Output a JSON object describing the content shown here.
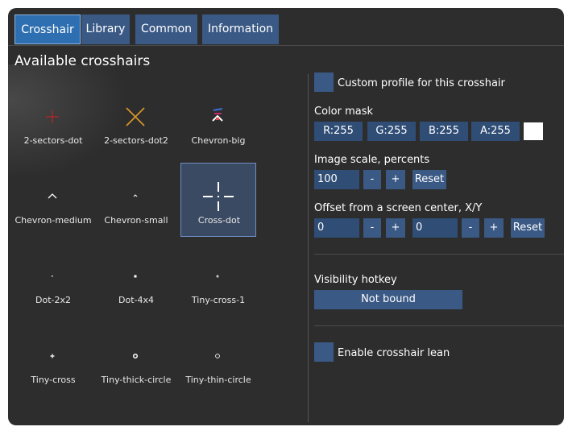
{
  "tabs": [
    {
      "label": "Crosshair"
    },
    {
      "label": "Library"
    },
    {
      "label": "Common"
    },
    {
      "label": "Information"
    }
  ],
  "section_title": "Available crosshairs",
  "crosshairs": [
    {
      "label": "2-sectors-dot",
      "icon": "red-plus-crosshair-icon"
    },
    {
      "label": "2-sectors-dot2",
      "icon": "orange-x-crosshair-icon"
    },
    {
      "label": "Chevron-big",
      "icon": "chevron-big-crosshair-icon"
    },
    {
      "label": "Chevron-medium",
      "icon": "chevron-medium-crosshair-icon"
    },
    {
      "label": "Chevron-small",
      "icon": "chevron-small-crosshair-icon"
    },
    {
      "label": "Cross-dot",
      "icon": "cross-dot-crosshair-icon",
      "selected": true
    },
    {
      "label": "Dot-2x2",
      "icon": "dot-2x2-crosshair-icon"
    },
    {
      "label": "Dot-4x4",
      "icon": "dot-4x4-crosshair-icon"
    },
    {
      "label": "Tiny-cross-1",
      "icon": "tiny-cross-1-crosshair-icon"
    },
    {
      "label": "Tiny-cross",
      "icon": "tiny-cross-crosshair-icon"
    },
    {
      "label": "Tiny-thick-circle",
      "icon": "tiny-thick-circle-crosshair-icon"
    },
    {
      "label": "Tiny-thin-circle",
      "icon": "tiny-thin-circle-crosshair-icon"
    }
  ],
  "settings": {
    "custom_profile_label": "Custom profile for this crosshair",
    "color_mask_label": "Color mask",
    "color_r": "R:255",
    "color_g": "G:255",
    "color_b": "B:255",
    "color_a": "A:255",
    "swatch_color": "#ffffff",
    "image_scale_label": "Image scale, percents",
    "image_scale_value": "100",
    "minus": "-",
    "plus": "+",
    "reset": "Reset",
    "offset_label": "Offset from a screen center, X/Y",
    "offset_x": "0",
    "offset_y": "0",
    "visibility_hotkey_label": "Visibility hotkey",
    "visibility_hotkey_value": "Not bound",
    "crosshair_lean_label": "Enable crosshair lean"
  },
  "colors": {
    "window_bg": "#2d2d2d",
    "tab_bg": "#3a5985",
    "tab_active_bg": "#2d6fb0",
    "field_bg": "#2f4d75",
    "selected_cell_bg": "#3b4a63"
  }
}
